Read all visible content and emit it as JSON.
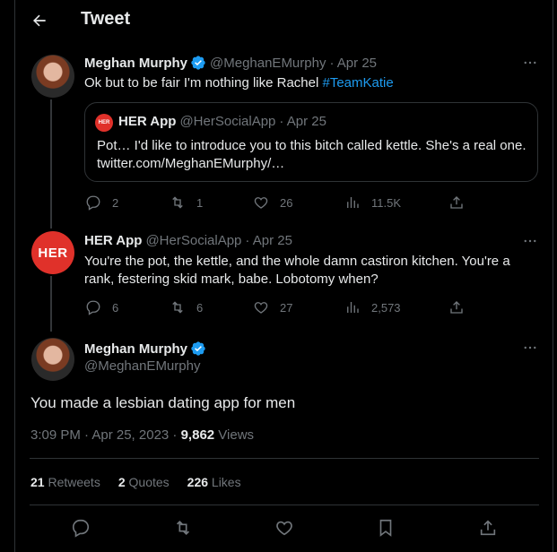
{
  "header": {
    "title": "Tweet"
  },
  "reply1": {
    "name": "Meghan Murphy",
    "handle": "@MeghanEMurphy",
    "date": "· Apr 25",
    "text": "Ok but to be fair I'm nothing like Rachel ",
    "hashtag": "#TeamKatie",
    "quote": {
      "avatar_text": "HER",
      "name": "HER App",
      "handle": "@HerSocialApp",
      "date": "· Apr 25",
      "text": "Pot… I'd like to introduce you to this bitch called kettle. She's a real one. twitter.com/MeghanEMurphy/…"
    },
    "stats": {
      "replies": "2",
      "retweets": "1",
      "likes": "26",
      "views": "11.5K"
    }
  },
  "reply2": {
    "avatar_text": "HER",
    "name": "HER App",
    "handle": "@HerSocialApp",
    "date": "· Apr 25",
    "text": "You're the pot, the kettle, and the whole damn castiron kitchen. You're a rank, festering skid mark, babe. Lobotomy when?",
    "stats": {
      "replies": "6",
      "retweets": "6",
      "likes": "27",
      "views": "2,573"
    }
  },
  "main": {
    "name": "Meghan Murphy",
    "handle": "@MeghanEMurphy",
    "text": "You made a lesbian dating app for men",
    "time": "3:09 PM · Apr 25, 2023 · ",
    "views_count": "9,862",
    "views_label": " Views",
    "retweets_count": "21",
    "retweets_label": " Retweets",
    "quotes_count": "2",
    "quotes_label": " Quotes",
    "likes_count": "226",
    "likes_label": " Likes"
  },
  "colors": {
    "accent": "#1d9bf0",
    "her_red": "#e0312a",
    "muted": "#71767b",
    "border": "#2f3336"
  }
}
